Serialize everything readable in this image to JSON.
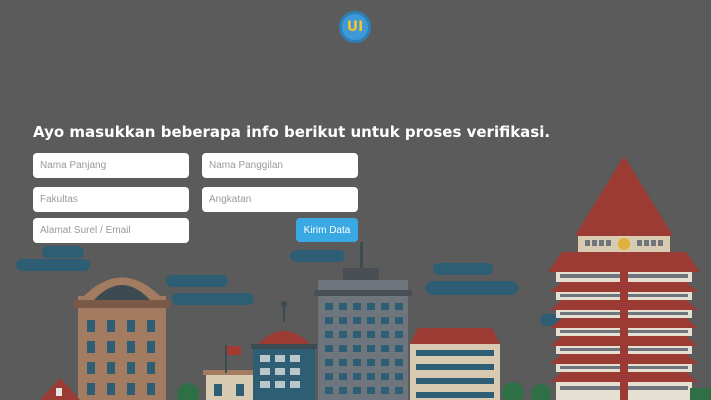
{
  "brand": {
    "logo_text": "UI"
  },
  "heading": "Ayo masukkan beberapa info berikut untuk proses verifikasi.",
  "form": {
    "full_name": {
      "placeholder": "Nama Panjang",
      "value": ""
    },
    "nickname": {
      "placeholder": "Nama Panggilan",
      "value": ""
    },
    "faculty": {
      "placeholder": "Fakultas",
      "value": ""
    },
    "batch": {
      "placeholder": "Angkatan",
      "value": ""
    },
    "email": {
      "placeholder": "Alamat Surel / Email",
      "value": ""
    },
    "submit_label": "Kirim Data"
  },
  "colors": {
    "background": "#5b5b5b",
    "accent": "#3aa8e2",
    "logo_ring": "#3d9ad6",
    "logo_text": "#f2c230"
  }
}
